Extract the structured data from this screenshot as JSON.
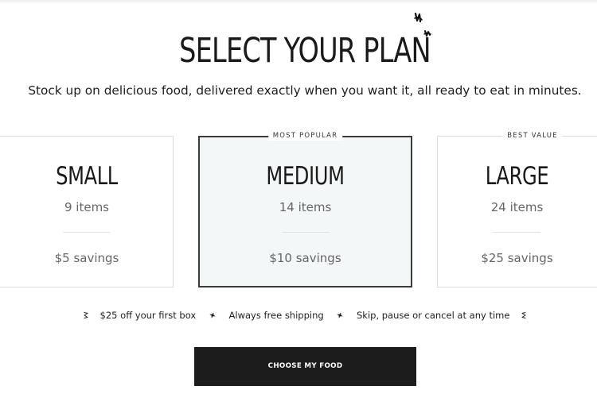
{
  "header": {
    "title": "SELECT YOUR PLAN",
    "subtitle": "Stock up on delicious food, delivered exactly when you want it, all ready to eat in minutes."
  },
  "decoration": {
    "icon": "sparkle-doodle-icon"
  },
  "plans": [
    {
      "badge": "",
      "name": "SMALL",
      "items": "9 items",
      "savings": "$5 savings",
      "selected": false
    },
    {
      "badge": "MOST POPULAR",
      "name": "MEDIUM",
      "items": "14 items",
      "savings": "$10 savings",
      "selected": true
    },
    {
      "badge": "BEST VALUE",
      "name": "LARGE",
      "items": "24 items",
      "savings": "$25 savings",
      "selected": false
    }
  ],
  "perks": [
    "$25 off your first box",
    "Always free shipping",
    "Skip, pause or cancel at any time"
  ],
  "cta": {
    "label": "CHOOSE MY FOOD"
  },
  "colors": {
    "selected_background": "#f3f7f7",
    "button_background": "#1c1c1c",
    "text_dark": "#1a1a1a",
    "text_muted": "#666666"
  }
}
